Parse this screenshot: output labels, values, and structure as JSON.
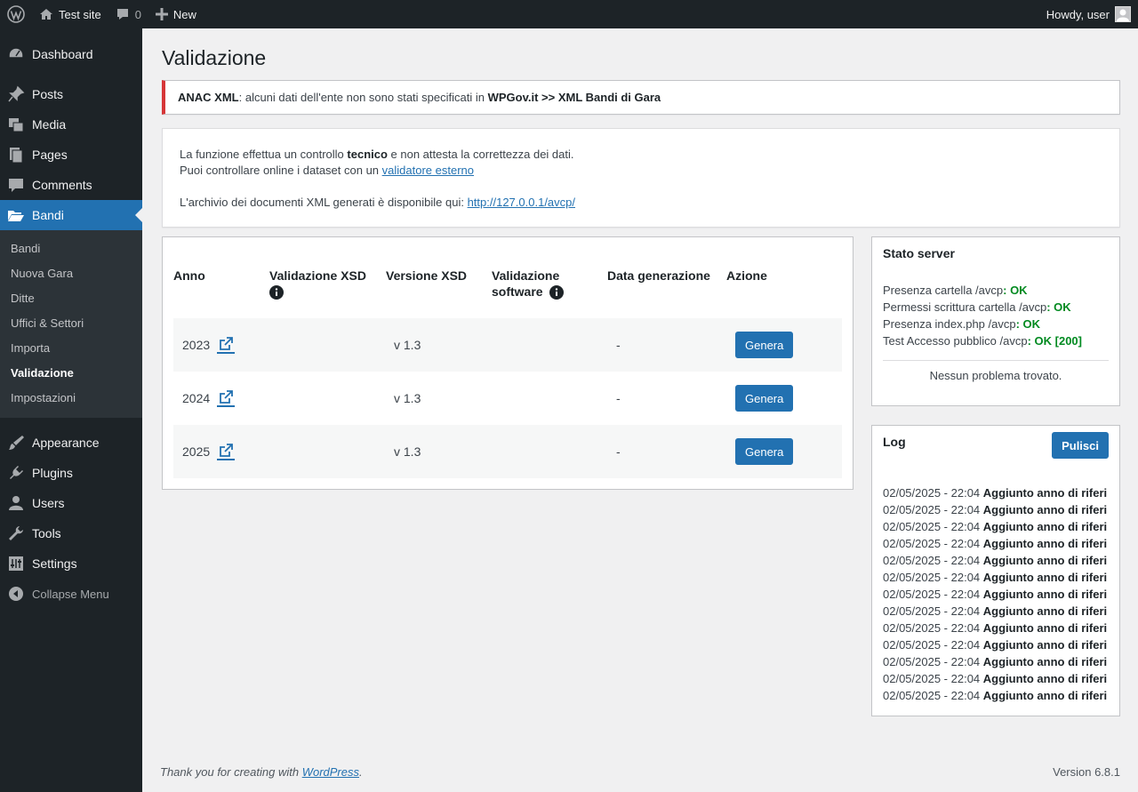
{
  "adminbar": {
    "site_name": "Test site",
    "comments_count": "0",
    "new_label": "New",
    "howdy": "Howdy, user"
  },
  "sidebar": {
    "items_top": [
      {
        "label": "Dashboard",
        "icon": "dashboard-icon"
      },
      {
        "label": "Posts",
        "icon": "pin-icon"
      },
      {
        "label": "Media",
        "icon": "media-icon"
      },
      {
        "label": "Pages",
        "icon": "pages-icon"
      },
      {
        "label": "Comments",
        "icon": "comment-icon"
      },
      {
        "label": "Bandi",
        "icon": "folder-open-icon"
      }
    ],
    "submenu": [
      "Bandi",
      "Nuova Gara",
      "Ditte",
      "Uffici & Settori",
      "Importa",
      "Validazione",
      "Impostazioni"
    ],
    "items_bottom": [
      {
        "label": "Appearance",
        "icon": "brush-icon"
      },
      {
        "label": "Plugins",
        "icon": "plugin-icon"
      },
      {
        "label": "Users",
        "icon": "user-icon"
      },
      {
        "label": "Tools",
        "icon": "wrench-icon"
      },
      {
        "label": "Settings",
        "icon": "settings-icon"
      }
    ],
    "collapse_label": "Collapse Menu"
  },
  "page": {
    "title": "Validazione"
  },
  "notice": {
    "strong1": "ANAC XML",
    "text": ": alcuni dati dell'ente non sono stati specificati in ",
    "strong2": "WPGov.it >> XML Bandi di Gara"
  },
  "info": {
    "line1_pre": "La funzione effettua un controllo ",
    "line1_bold": "tecnico",
    "line1_post": " e non attesta la correttezza dei dati.",
    "line2_pre": "Puoi controllare online i dataset con un ",
    "line2_link": "validatore esterno",
    "line3_pre": "L'archivio dei documenti XML generati è disponibile qui: ",
    "line3_link": "http://127.0.0.1/avcp/"
  },
  "table": {
    "headers": {
      "anno": "Anno",
      "validazione_xsd": "Validazione XSD",
      "versione_xsd": "Versione XSD",
      "validazione_software_1": "Validazione",
      "validazione_software_2": "software",
      "data_generazione": "Data generazione",
      "azione": "Azione"
    },
    "rows": [
      {
        "anno": "2023",
        "versione": "v 1.3",
        "data": "-",
        "azione": "Genera"
      },
      {
        "anno": "2024",
        "versione": "v 1.3",
        "data": "-",
        "azione": "Genera"
      },
      {
        "anno": "2025",
        "versione": "v 1.3",
        "data": "-",
        "azione": "Genera"
      }
    ]
  },
  "server": {
    "title": "Stato server",
    "checks": [
      {
        "label": "Presenza cartella /avcp",
        "status": ": OK"
      },
      {
        "label": "Permessi scrittura cartella /avcp",
        "status": ": OK"
      },
      {
        "label": "Presenza index.php /avcp",
        "status": ": OK"
      },
      {
        "label": "Test Accesso pubblico /avcp",
        "status": ": OK [200]"
      }
    ],
    "result": "Nessun problema trovato."
  },
  "log": {
    "title": "Log",
    "clear_label": "Pulisci",
    "entries": [
      {
        "time": "02/05/2025 - 22:04 ",
        "msg": "Aggiunto anno di riferi"
      },
      {
        "time": "02/05/2025 - 22:04 ",
        "msg": "Aggiunto anno di riferi"
      },
      {
        "time": "02/05/2025 - 22:04 ",
        "msg": "Aggiunto anno di riferi"
      },
      {
        "time": "02/05/2025 - 22:04 ",
        "msg": "Aggiunto anno di riferi"
      },
      {
        "time": "02/05/2025 - 22:04 ",
        "msg": "Aggiunto anno di riferi"
      },
      {
        "time": "02/05/2025 - 22:04 ",
        "msg": "Aggiunto anno di riferi"
      },
      {
        "time": "02/05/2025 - 22:04 ",
        "msg": "Aggiunto anno di riferi"
      },
      {
        "time": "02/05/2025 - 22:04 ",
        "msg": "Aggiunto anno di riferi"
      },
      {
        "time": "02/05/2025 - 22:04 ",
        "msg": "Aggiunto anno di riferi"
      },
      {
        "time": "02/05/2025 - 22:04 ",
        "msg": "Aggiunto anno di riferi"
      },
      {
        "time": "02/05/2025 - 22:04 ",
        "msg": "Aggiunto anno di riferi"
      },
      {
        "time": "02/05/2025 - 22:04 ",
        "msg": "Aggiunto anno di riferi"
      },
      {
        "time": "02/05/2025 - 22:04 ",
        "msg": "Aggiunto anno di riferi"
      }
    ]
  },
  "footer": {
    "thanks_pre": "Thank you for creating with ",
    "thanks_link": "WordPress",
    "thanks_post": ".",
    "version": "Version 6.8.1"
  },
  "colors": {
    "accent": "#2271b1",
    "ok": "#008a20",
    "error": "#d63638",
    "sidebar_bg": "#1d2327"
  }
}
